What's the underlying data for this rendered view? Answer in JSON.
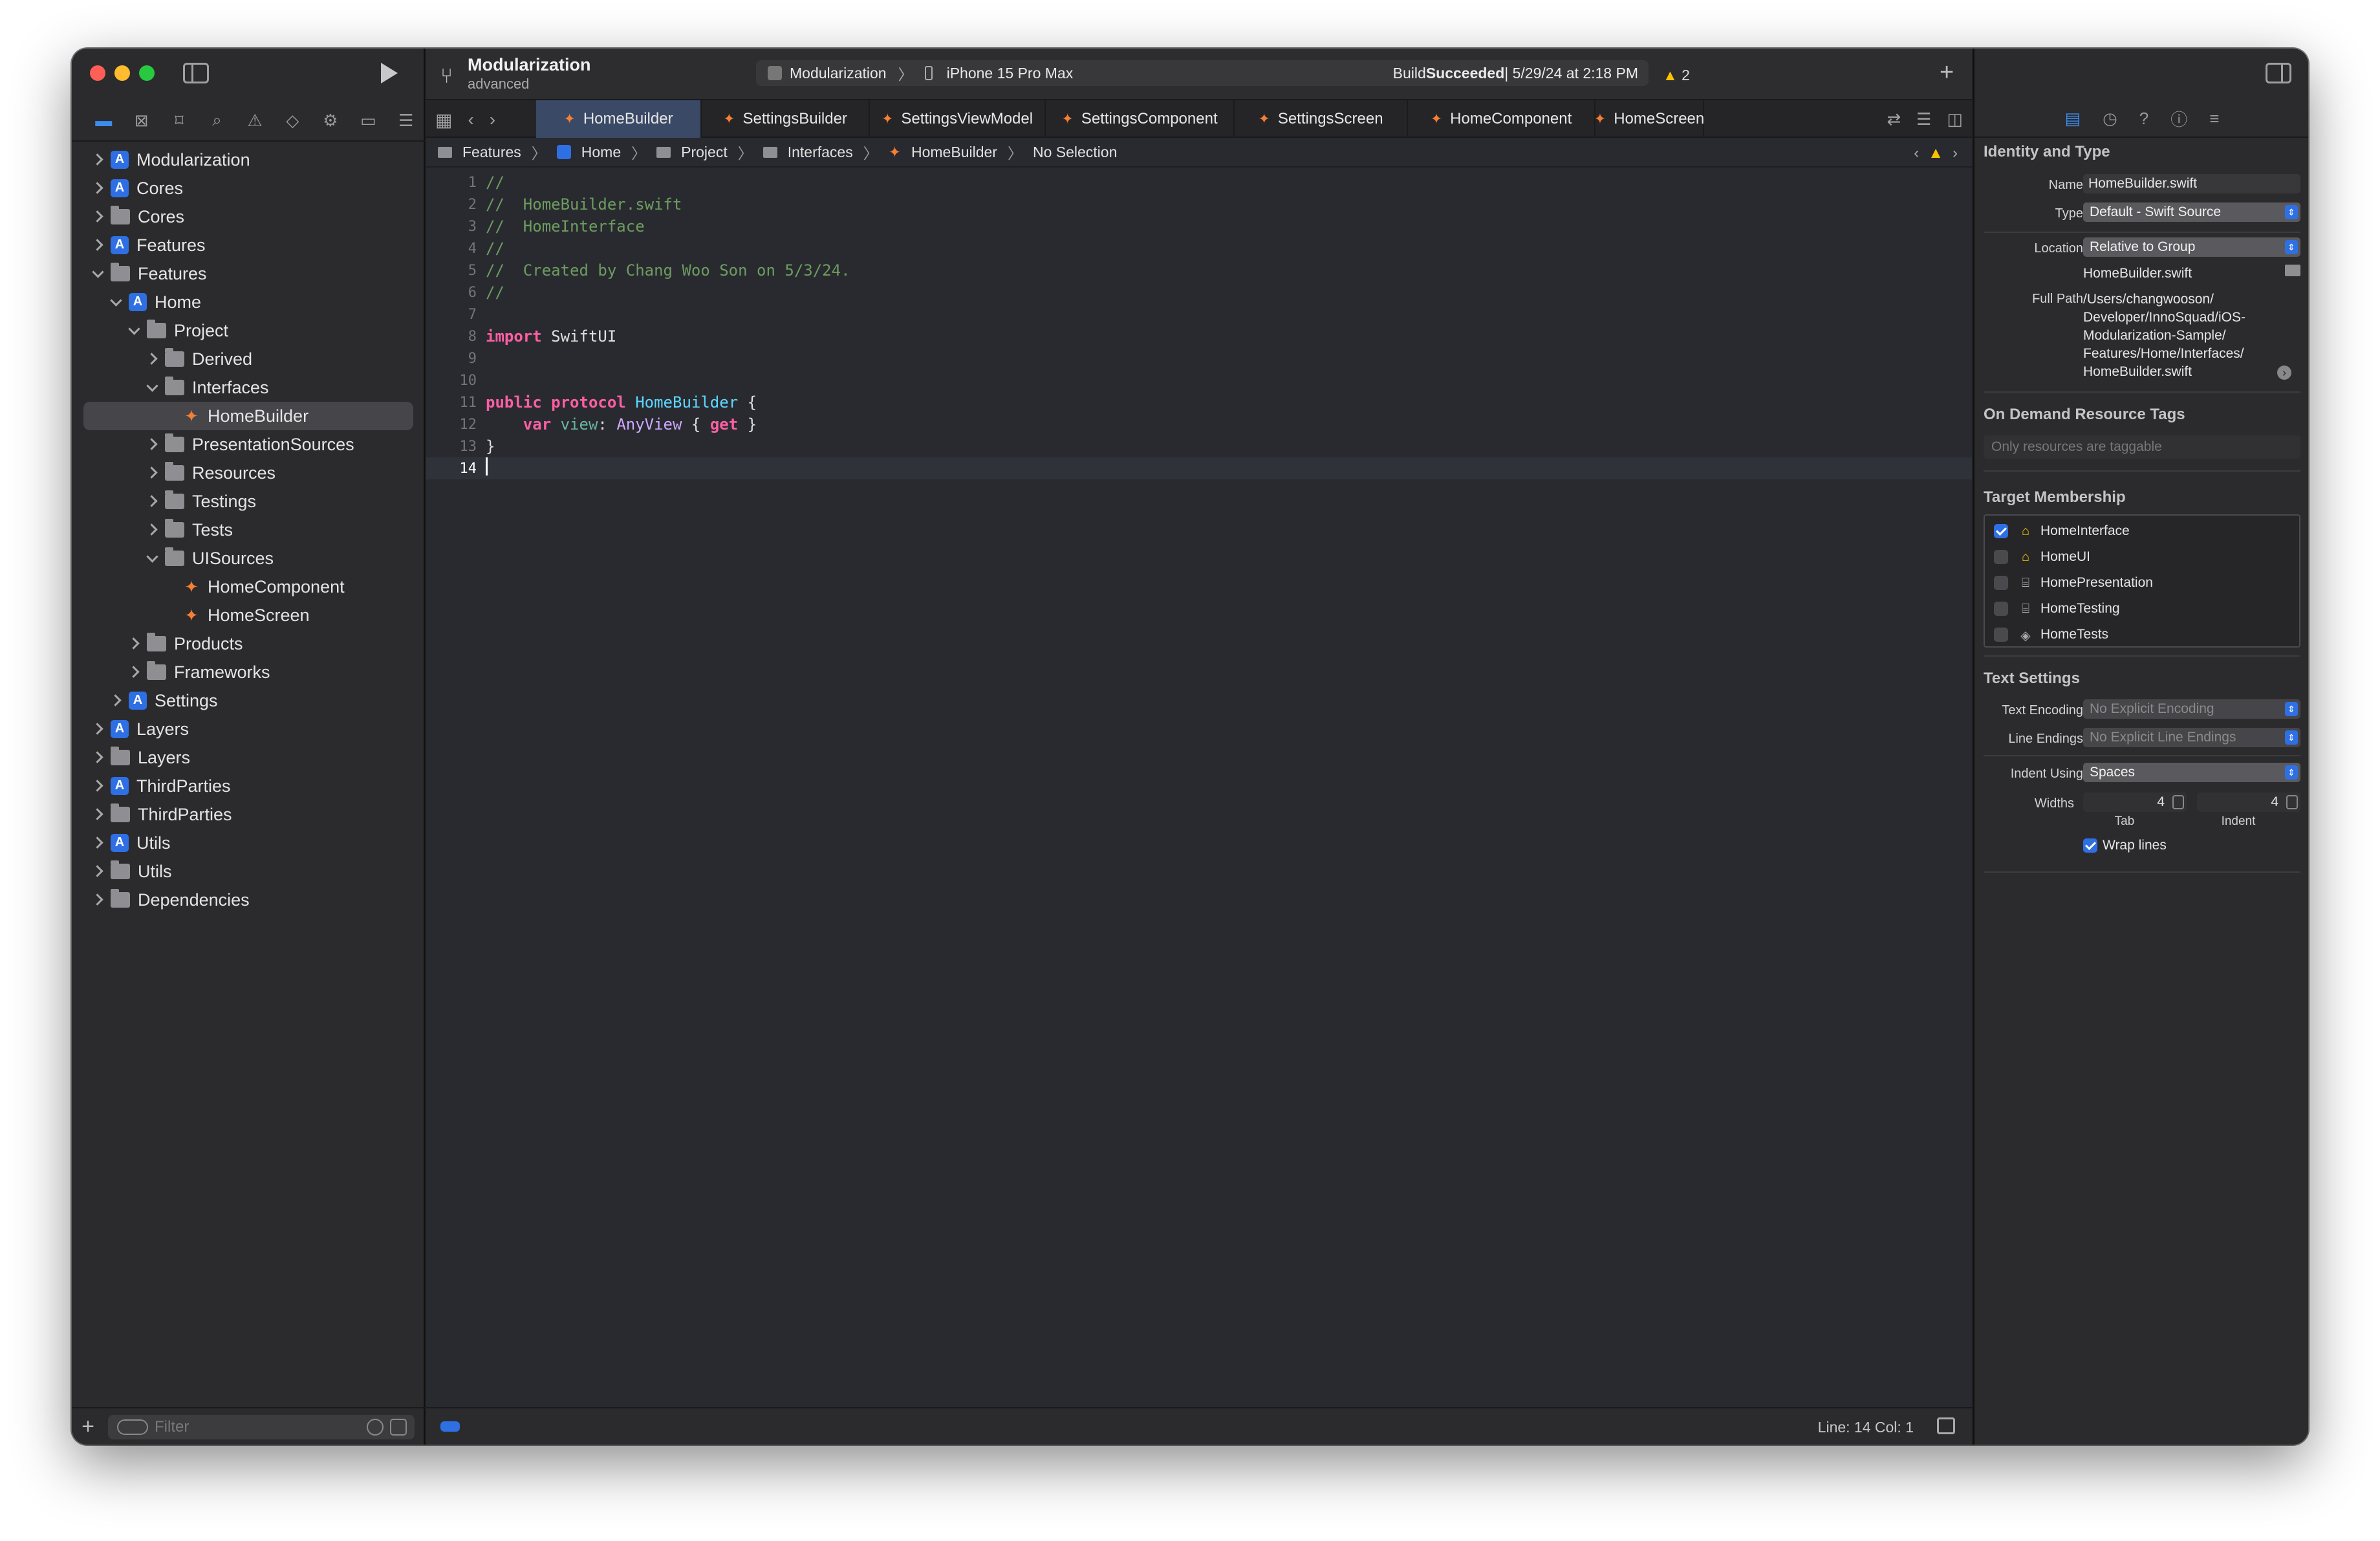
{
  "navigator": {
    "filter_placeholder": "Filter",
    "tree": [
      {
        "label": "Modularization",
        "icon": "project",
        "depth": 0,
        "state": "closed"
      },
      {
        "label": "Cores",
        "icon": "project",
        "depth": 0,
        "state": "closed"
      },
      {
        "label": "Cores",
        "icon": "folder",
        "depth": 0,
        "state": "closed"
      },
      {
        "label": "Features",
        "icon": "project",
        "depth": 0,
        "state": "closed"
      },
      {
        "label": "Features",
        "icon": "folder",
        "depth": 0,
        "state": "open"
      },
      {
        "label": "Home",
        "icon": "project",
        "depth": 1,
        "state": "open"
      },
      {
        "label": "Project",
        "icon": "folder",
        "depth": 2,
        "state": "open"
      },
      {
        "label": "Derived",
        "icon": "folder",
        "depth": 3,
        "state": "closed"
      },
      {
        "label": "Interfaces",
        "icon": "folder",
        "depth": 3,
        "state": "open"
      },
      {
        "label": "HomeBuilder",
        "icon": "swift",
        "depth": 4,
        "state": "none",
        "selected": true
      },
      {
        "label": "PresentationSources",
        "icon": "folder",
        "depth": 3,
        "state": "closed"
      },
      {
        "label": "Resources",
        "icon": "folder",
        "depth": 3,
        "state": "closed"
      },
      {
        "label": "Testings",
        "icon": "folder",
        "depth": 3,
        "state": "closed"
      },
      {
        "label": "Tests",
        "icon": "folder",
        "depth": 3,
        "state": "closed"
      },
      {
        "label": "UISources",
        "icon": "folder",
        "depth": 3,
        "state": "open"
      },
      {
        "label": "HomeComponent",
        "icon": "swift",
        "depth": 4,
        "state": "none"
      },
      {
        "label": "HomeScreen",
        "icon": "swift",
        "depth": 4,
        "state": "none"
      },
      {
        "label": "Products",
        "icon": "folder",
        "depth": 2,
        "state": "closed"
      },
      {
        "label": "Frameworks",
        "icon": "folder",
        "depth": 2,
        "state": "closed"
      },
      {
        "label": "Settings",
        "icon": "project",
        "depth": 1,
        "state": "closed"
      },
      {
        "label": "Layers",
        "icon": "project",
        "depth": 0,
        "state": "closed"
      },
      {
        "label": "Layers",
        "icon": "folder",
        "depth": 0,
        "state": "closed"
      },
      {
        "label": "ThirdParties",
        "icon": "project",
        "depth": 0,
        "state": "closed"
      },
      {
        "label": "ThirdParties",
        "icon": "folder",
        "depth": 0,
        "state": "closed"
      },
      {
        "label": "Utils",
        "icon": "project",
        "depth": 0,
        "state": "closed"
      },
      {
        "label": "Utils",
        "icon": "folder",
        "depth": 0,
        "state": "closed"
      },
      {
        "label": "Dependencies",
        "icon": "folder",
        "depth": 0,
        "state": "closed"
      }
    ]
  },
  "toolbar": {
    "project_name": "Modularization",
    "branch": "advanced",
    "scheme": "Modularization",
    "device": "iPhone 15 Pro Max",
    "build_prefix": "Build ",
    "build_status": "Succeeded",
    "build_time": " | 5/29/24 at 2:18 PM",
    "warning_count": "2"
  },
  "tabs": [
    {
      "label": "HomeBuilder",
      "active": true
    },
    {
      "label": "SettingsBuilder"
    },
    {
      "label": "SettingsViewModel"
    },
    {
      "label": "SettingsComponent"
    },
    {
      "label": "SettingsScreen"
    },
    {
      "label": "HomeComponent"
    },
    {
      "label": "HomeScreen"
    }
  ],
  "jumpbar": {
    "features": "Features",
    "home": "Home",
    "project": "Project",
    "interfaces": "Interfaces",
    "file": "HomeBuilder",
    "selection": "No Selection"
  },
  "code": [
    {
      "n": "1",
      "t": [
        [
          "cm",
          "//"
        ]
      ]
    },
    {
      "n": "2",
      "t": [
        [
          "cm",
          "//  HomeBuilder.swift"
        ]
      ]
    },
    {
      "n": "3",
      "t": [
        [
          "cm",
          "//  HomeInterface"
        ]
      ]
    },
    {
      "n": "4",
      "t": [
        [
          "cm",
          "//"
        ]
      ]
    },
    {
      "n": "5",
      "t": [
        [
          "cm",
          "//  Created by Chang Woo Son on 5/3/24."
        ]
      ]
    },
    {
      "n": "6",
      "t": [
        [
          "cm",
          "//"
        ]
      ]
    },
    {
      "n": "7",
      "t": []
    },
    {
      "n": "8",
      "t": [
        [
          "kw",
          "import"
        ],
        [
          "",
          " SwiftUI"
        ]
      ]
    },
    {
      "n": "9",
      "t": []
    },
    {
      "n": "10",
      "t": []
    },
    {
      "n": "11",
      "t": [
        [
          "kw",
          "public"
        ],
        [
          "",
          " "
        ],
        [
          "kw",
          "protocol"
        ],
        [
          "",
          " "
        ],
        [
          "decl",
          "HomeBuilder"
        ],
        [
          "",
          " {"
        ]
      ]
    },
    {
      "n": "12",
      "t": [
        [
          "",
          "    "
        ],
        [
          "kw",
          "var"
        ],
        [
          "",
          " "
        ],
        [
          "prop",
          "view"
        ],
        [
          "",
          ": "
        ],
        [
          "ty",
          "AnyView"
        ],
        [
          "",
          " { "
        ],
        [
          "kw",
          "get"
        ],
        [
          "",
          " }"
        ]
      ]
    },
    {
      "n": "13",
      "t": [
        [
          "",
          "}"
        ]
      ]
    },
    {
      "n": "14",
      "t": [],
      "current": true
    }
  ],
  "status": {
    "line_col": "Line: 14  Col: 1"
  },
  "inspector": {
    "identity_title": "Identity and Type",
    "name_label": "Name",
    "name_value": "HomeBuilder.swift",
    "type_label": "Type",
    "type_value": "Default - Swift Source",
    "location_label": "Location",
    "location_value": "Relative to Group",
    "location_file": "HomeBuilder.swift",
    "fullpath_label": "Full Path",
    "fullpath_lines": [
      "/Users/changwooson/",
      "Developer/InnoSquad/iOS-",
      "Modularization-Sample/",
      "Features/Home/Interfaces/",
      "HomeBuilder.swift"
    ],
    "odr_title": "On Demand Resource Tags",
    "odr_placeholder": "Only resources are taggable",
    "membership_title": "Target Membership",
    "membership": [
      {
        "label": "HomeInterface",
        "checked": true,
        "icon": "framework"
      },
      {
        "label": "HomeUI",
        "checked": false,
        "icon": "framework"
      },
      {
        "label": "HomePresentation",
        "checked": false,
        "icon": "library"
      },
      {
        "label": "HomeTesting",
        "checked": false,
        "icon": "library"
      },
      {
        "label": "HomeTests",
        "checked": false,
        "icon": "test"
      }
    ],
    "text_title": "Text Settings",
    "encoding_label": "Text Encoding",
    "encoding_value": "No Explicit Encoding",
    "endings_label": "Line Endings",
    "endings_value": "No Explicit Line Endings",
    "indent_label": "Indent Using",
    "indent_value": "Spaces",
    "widths_label": "Widths",
    "tab_width": "4",
    "indent_width": "4",
    "tab_label": "Tab",
    "indent_sub_label": "Indent",
    "wrap_label": "Wrap lines"
  },
  "colors": {
    "accent": "#2f6fe4",
    "swift": "#f57f33",
    "comment": "#6c9d5f",
    "keyword": "#fc5fa3"
  }
}
